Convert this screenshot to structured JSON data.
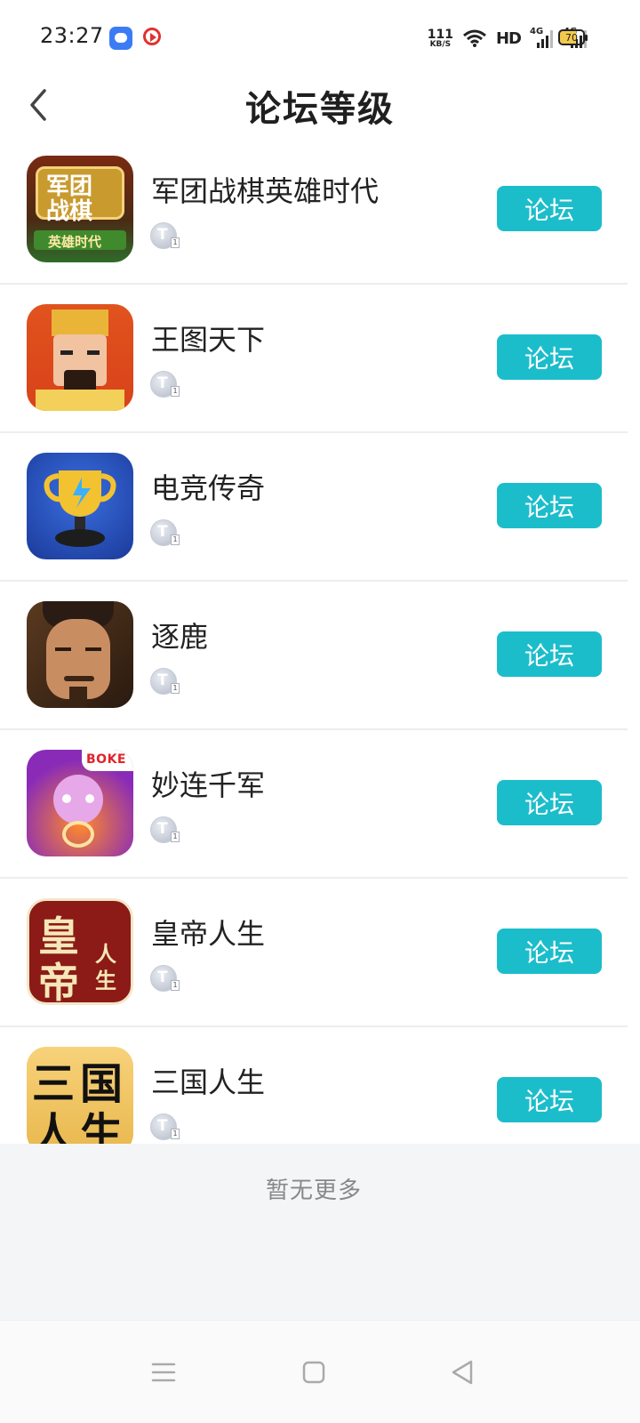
{
  "status_bar": {
    "time": "23:27",
    "net_speed_value": "111",
    "net_speed_unit": "KB/S",
    "hd_label": "HD",
    "signal1_label": "4G",
    "signal2_label": "4G",
    "battery_level": "70"
  },
  "header": {
    "title": "论坛等级"
  },
  "games": [
    {
      "name": "军团战棋英雄时代",
      "button_label": "论坛",
      "icon": "legion-chess-icon"
    },
    {
      "name": "王图天下",
      "button_label": "论坛",
      "icon": "king-portrait-icon"
    },
    {
      "name": "电竞传奇",
      "button_label": "论坛",
      "icon": "trophy-icon"
    },
    {
      "name": "逐鹿",
      "button_label": "论坛",
      "icon": "warrior-portrait-icon"
    },
    {
      "name": "妙连千军",
      "button_label": "论坛",
      "icon": "cartoon-hero-icon"
    },
    {
      "name": "皇帝人生",
      "button_label": "论坛",
      "icon": "emperor-life-icon"
    },
    {
      "name": "三国人生",
      "button_label": "论坛",
      "icon": "three-kingdoms-life-icon"
    }
  ],
  "icon_texts": {
    "legion_line1": "军团",
    "legion_line2": "战棋",
    "legion_banner": "英雄时代",
    "boke": "BOKE",
    "emperor_main1": "皇",
    "emperor_main2": "帝",
    "emperor_side1": "人",
    "emperor_side2": "生",
    "tk_1": "三",
    "tk_2": "国",
    "tk_3": "人",
    "tk_4": "生"
  },
  "badge_text": "T",
  "badge_level": "1",
  "footer": {
    "no_more": "暂无更多"
  },
  "colors": {
    "accent": "#1cbdcb",
    "divider": "#ebedf0",
    "footer_bg": "#f4f5f7"
  }
}
